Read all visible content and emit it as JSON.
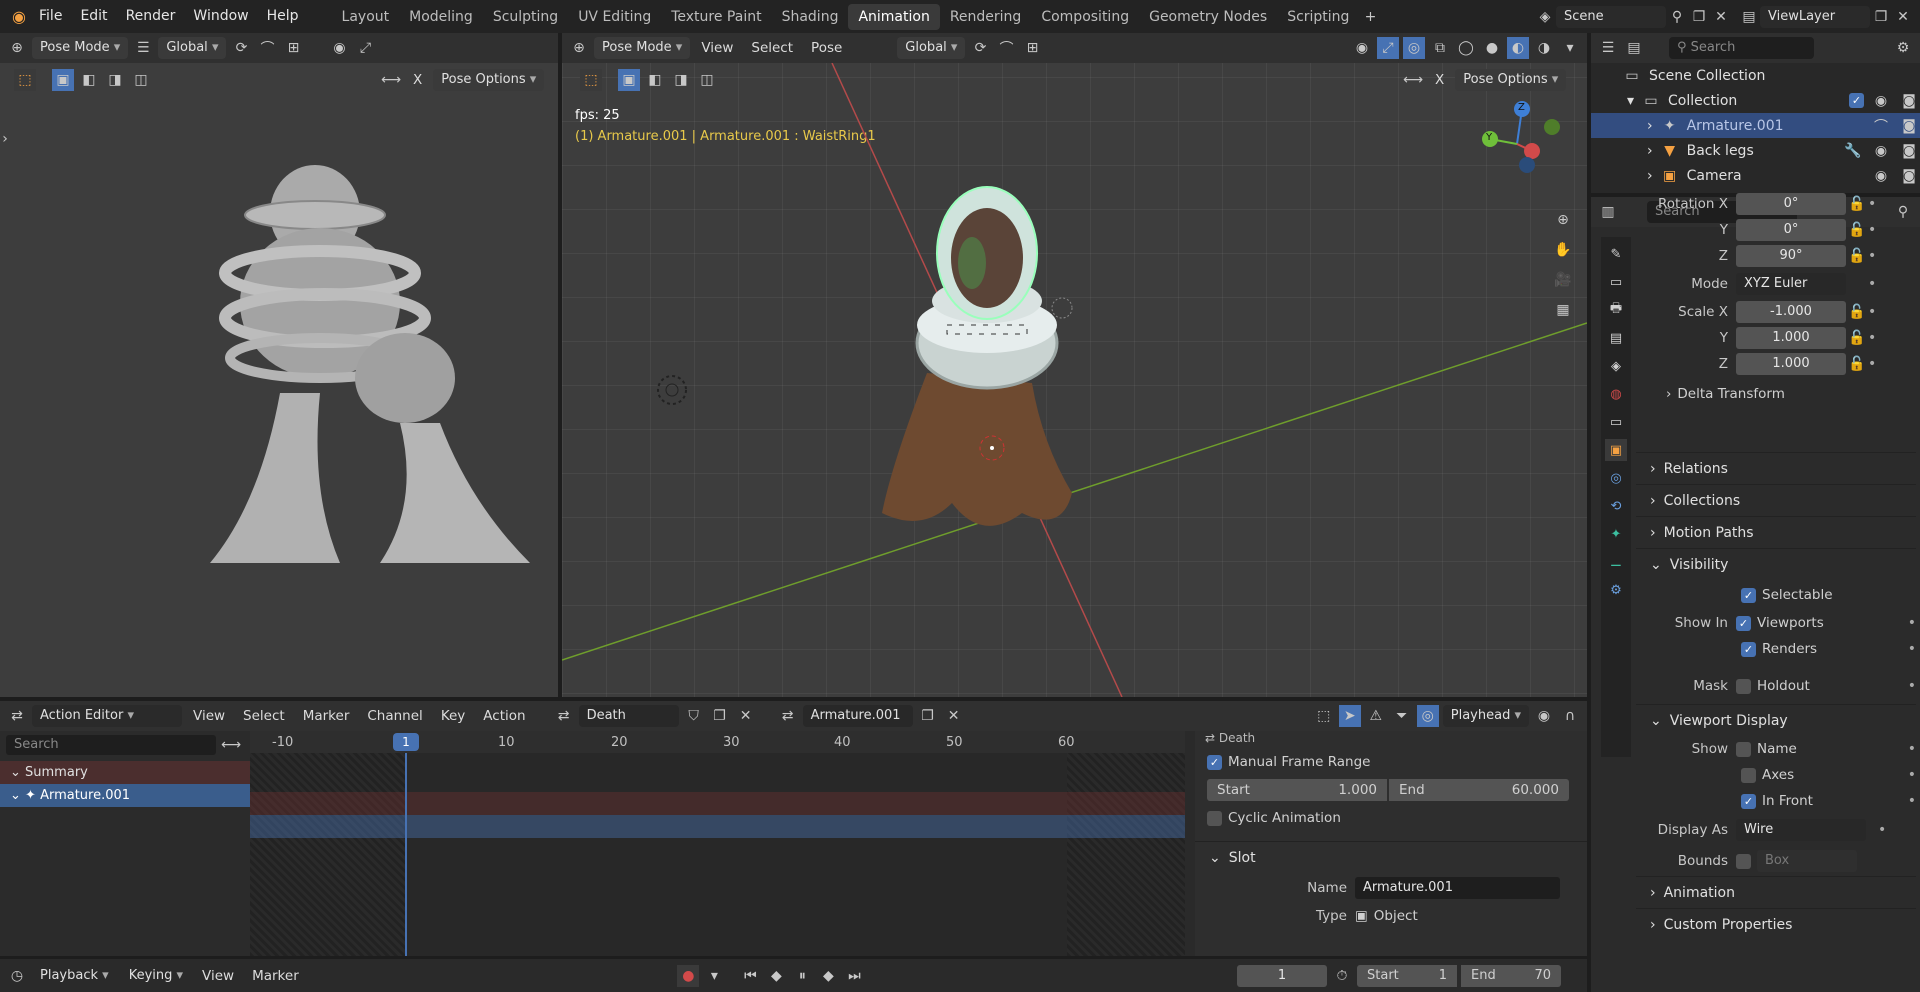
{
  "menubar": {
    "menus": [
      "File",
      "Edit",
      "Render",
      "Window",
      "Help"
    ],
    "workspaces": [
      "Layout",
      "Modeling",
      "Sculpting",
      "UV Editing",
      "Texture Paint",
      "Shading",
      "Animation",
      "Rendering",
      "Compositing",
      "Geometry Nodes",
      "Scripting"
    ],
    "active_workspace": "Animation",
    "scene": "Scene",
    "view_layer": "ViewLayer"
  },
  "left_view": {
    "mode": "Pose Mode",
    "orientation": "Global",
    "options": "Pose Options",
    "x_label": "X"
  },
  "main_view": {
    "mode": "Pose Mode",
    "menus": [
      "View",
      "Select",
      "Pose"
    ],
    "orientation": "Global",
    "options": "Pose Options",
    "x_label": "X",
    "fps": "fps: 25",
    "info": "(1) Armature.001 | Armature.001 : WaistRing1",
    "gizmo": {
      "x": "X",
      "y": "Y",
      "z": "Z"
    }
  },
  "outliner": {
    "search_placeholder": "Search",
    "root": "Scene Collection",
    "collection": "Collection",
    "items": [
      "Armature.001",
      "Back legs",
      "Camera"
    ]
  },
  "properties": {
    "search_placeholder": "Search",
    "rotation_x_label": "Rotation X",
    "rotation_x": "0°",
    "rotation_y_label": "Y",
    "rotation_y": "0°",
    "rotation_z_label": "Z",
    "rotation_z": "90°",
    "mode_label": "Mode",
    "mode": "XYZ Euler",
    "scale_x_label": "Scale X",
    "scale_x": "-1.000",
    "scale_y_label": "Y",
    "scale_y": "1.000",
    "scale_z_label": "Z",
    "scale_z": "1.000",
    "delta_transform": "Delta Transform",
    "sections": [
      "Relations",
      "Collections",
      "Motion Paths"
    ],
    "visibility": {
      "title": "Visibility",
      "selectable": "Selectable",
      "show_in": "Show In",
      "viewports": "Viewports",
      "renders": "Renders",
      "mask": "Mask",
      "holdout": "Holdout"
    },
    "viewport_display": {
      "title": "Viewport Display",
      "show": "Show",
      "name": "Name",
      "axes": "Axes",
      "in_front": "In Front",
      "display_as_label": "Display As",
      "display_as": "Wire",
      "bounds_label": "Bounds",
      "bounds": "Box"
    },
    "animation": "Animation",
    "custom_properties": "Custom Properties"
  },
  "action_editor": {
    "editor": "Action Editor",
    "menus": [
      "View",
      "Select",
      "Marker",
      "Channel",
      "Key",
      "Action"
    ],
    "action": "Death",
    "slot": "Armature.001",
    "playhead": "Playhead",
    "search_placeholder": "Search",
    "ruler": [
      "-10",
      "1",
      "10",
      "20",
      "30",
      "40",
      "50",
      "60"
    ],
    "channels": [
      "Summary",
      "Armature.001"
    ],
    "sidebar": {
      "action_name": "Death",
      "manual_frame_range": "Manual Frame Range",
      "start_label": "Start",
      "start": "1.000",
      "end_label": "End",
      "end": "60.000",
      "cyclic": "Cyclic Animation",
      "slot_title": "Slot",
      "name_label": "Name",
      "name": "Armature.001",
      "type_label": "Type",
      "type": "Object"
    }
  },
  "timeline": {
    "menus": [
      "Playback",
      "Keying",
      "View",
      "Marker"
    ],
    "current_frame": "1",
    "start_label": "Start",
    "start": "1",
    "end_label": "End",
    "end": "70"
  }
}
